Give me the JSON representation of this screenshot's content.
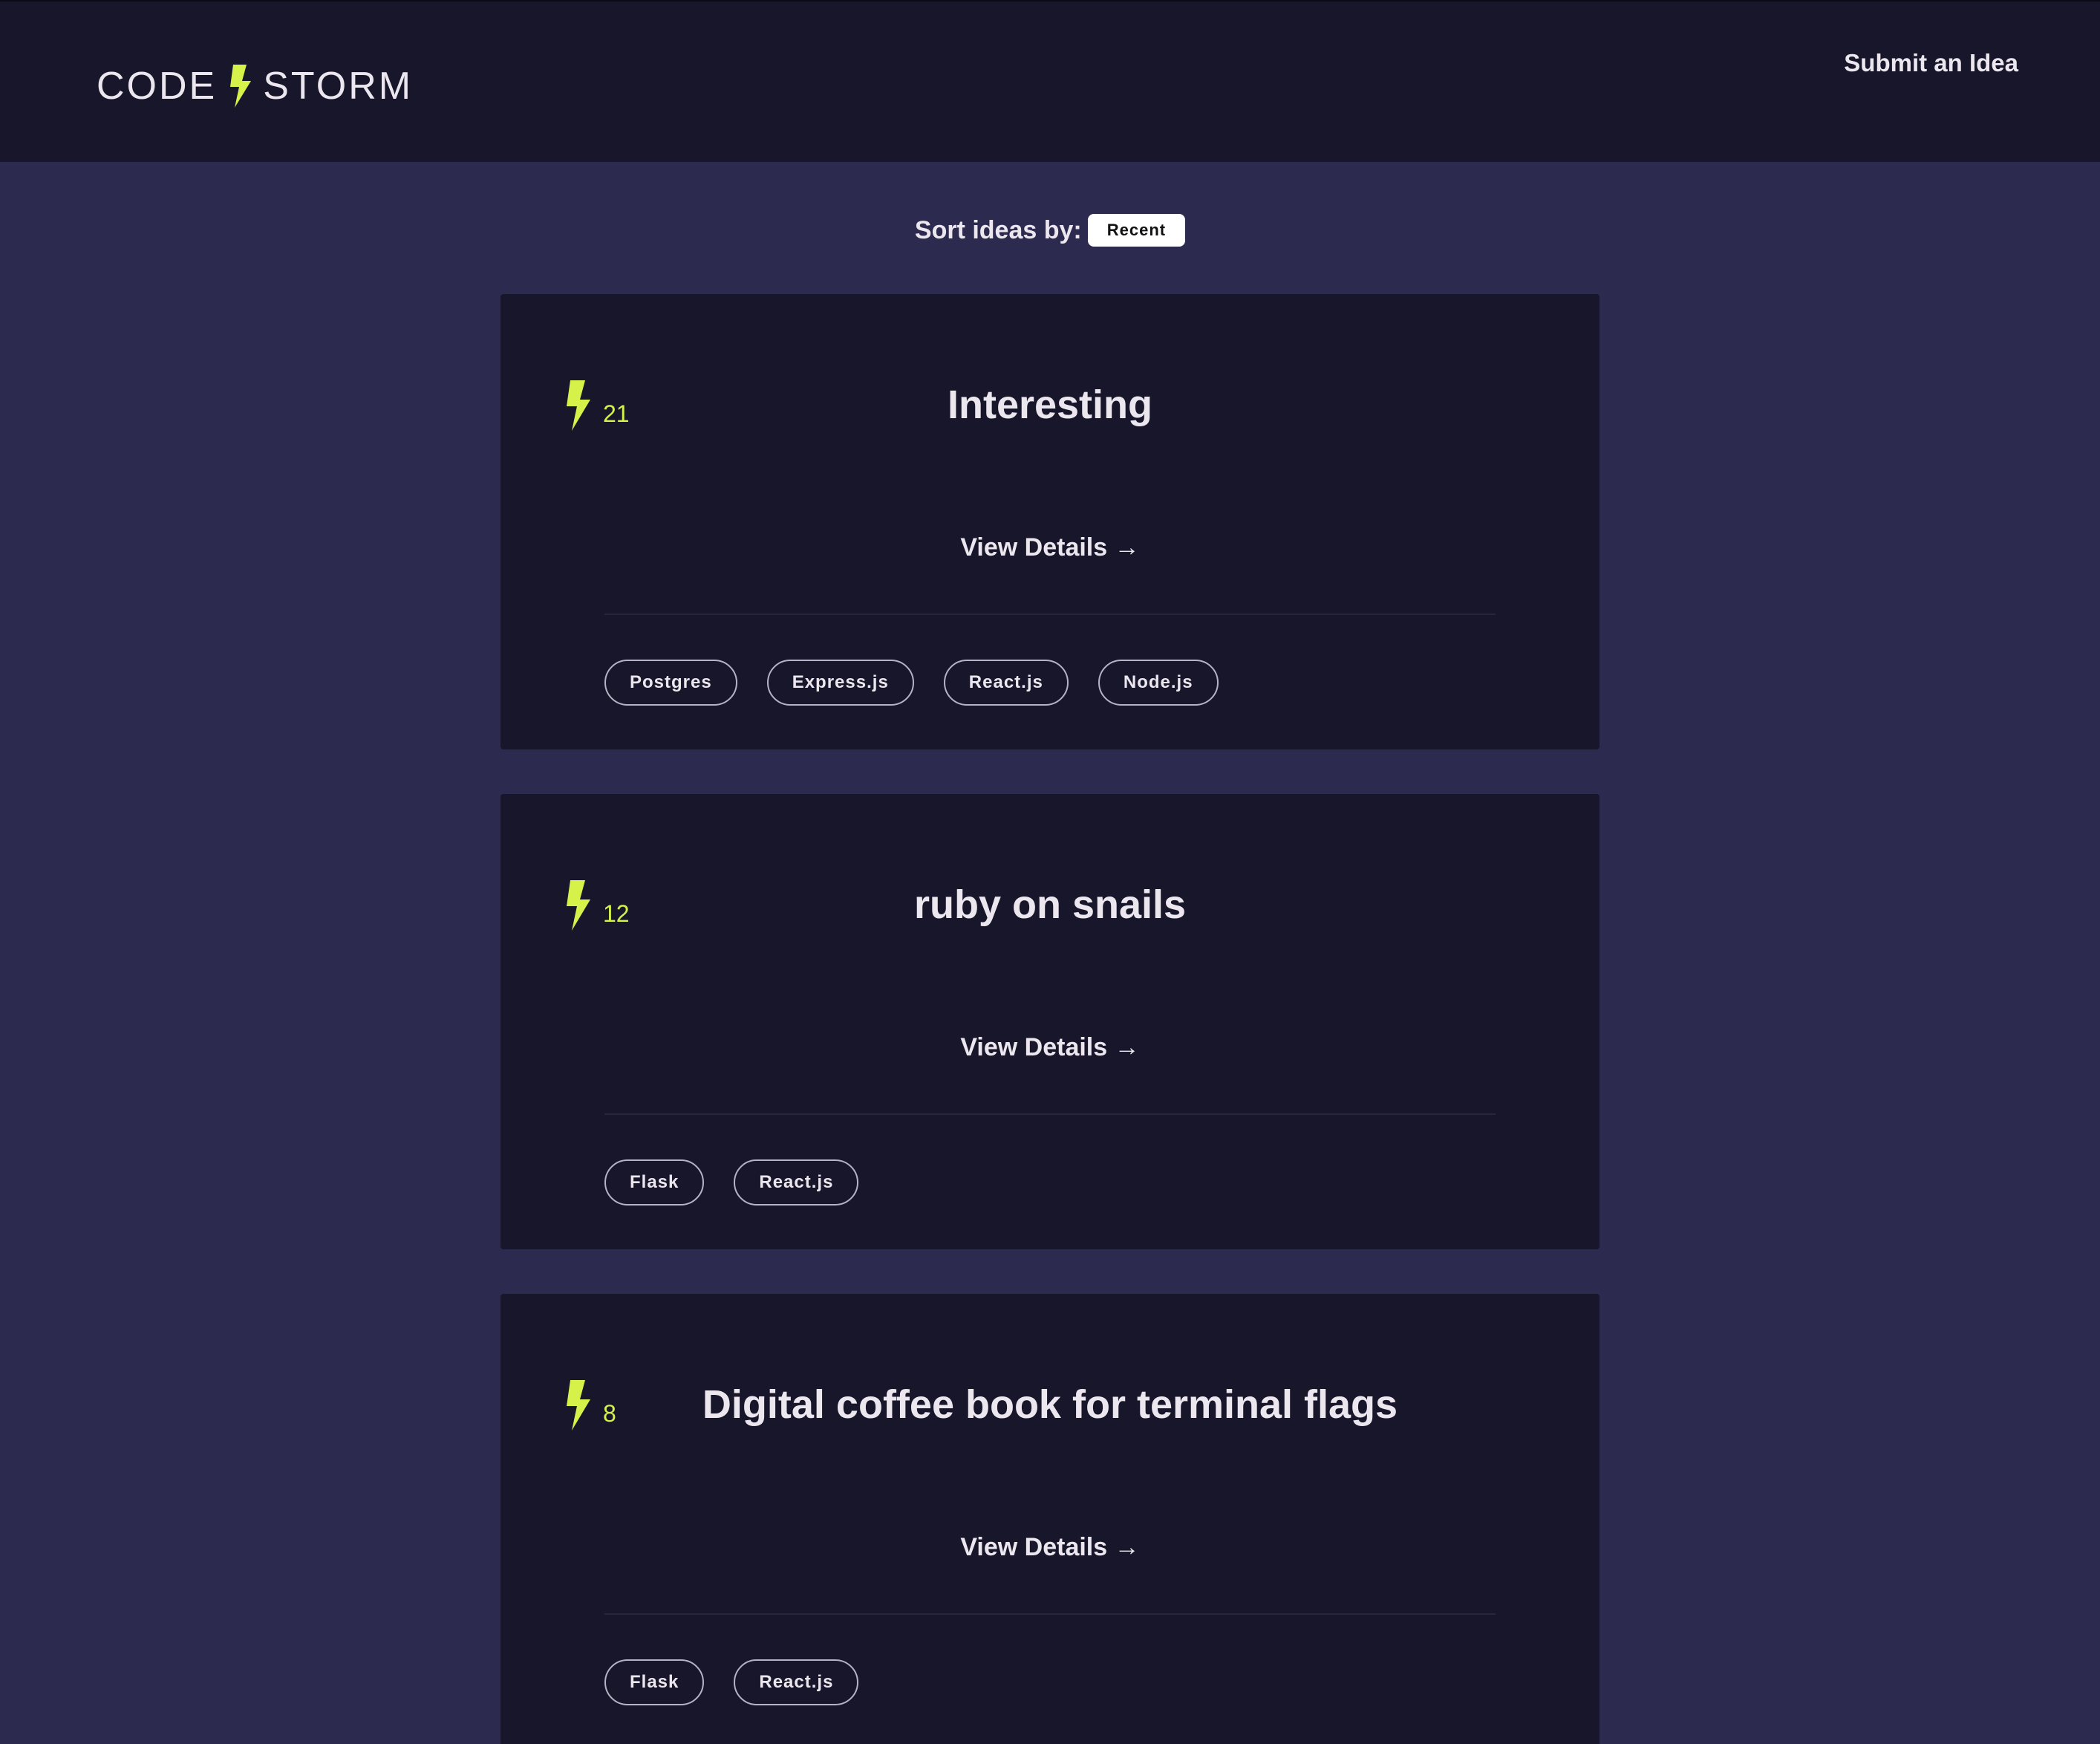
{
  "header": {
    "brand_left": "CODE",
    "brand_right": "STORM",
    "submit_label": "Submit an Idea"
  },
  "sort": {
    "label": "Sort ideas by:",
    "selected": "Recent"
  },
  "colors": {
    "accent": "#d6f24a",
    "header_bg": "#18162a",
    "page_bg": "#2d2a4f",
    "card_bg": "#18162a"
  },
  "ideas": [
    {
      "votes": "21",
      "title": "Interesting",
      "details_label": "View Details →",
      "tags": [
        "Postgres",
        "Express.js",
        "React.js",
        "Node.js"
      ]
    },
    {
      "votes": "12",
      "title": "ruby on snails",
      "details_label": "View Details →",
      "tags": [
        "Flask",
        "React.js"
      ]
    },
    {
      "votes": "8",
      "title": "Digital coffee book for terminal flags",
      "details_label": "View Details →",
      "tags": [
        "Flask",
        "React.js"
      ]
    }
  ]
}
